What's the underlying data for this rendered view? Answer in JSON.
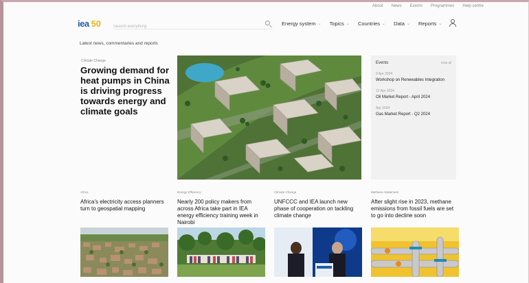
{
  "utility_nav": [
    "About",
    "News",
    "Events",
    "Programmes",
    "Help centre"
  ],
  "logo": {
    "iea": "iea",
    "fifty": "50"
  },
  "search": {
    "placeholder": "Search everything"
  },
  "nav": [
    {
      "label": "Energy system"
    },
    {
      "label": "Topics"
    },
    {
      "label": "Countries"
    },
    {
      "label": "Data"
    },
    {
      "label": "Reports"
    }
  ],
  "section_label": "Latest news, commentaries and reports",
  "hero": {
    "category": "Climate Change",
    "title": "Growing demand for heat pumps in China is driving progress towards energy and climate goals"
  },
  "events": {
    "heading": "Events",
    "view_all": "View all",
    "items": [
      {
        "date": "9 Apr 2024",
        "name": "Workshop on Renewables Integration"
      },
      {
        "date": "12 Apr 2024",
        "name": "Oil Market Report - April 2024"
      },
      {
        "date": "Apr 2024",
        "name": "Gas Market Report - Q2 2024"
      }
    ]
  },
  "cards": [
    {
      "category": "Africa",
      "title": "Africa's electricity access planners turn to geospatial mapping"
    },
    {
      "category": "Energy Efficiency",
      "title": "Nearly 200 policy makers from across Africa take part in IEA energy efficiency training week in Nairobi"
    },
    {
      "category": "Climate Change",
      "title": "UNFCCC and IEA launch new phase of cooperation on tackling climate change"
    },
    {
      "category": "Methane Abatement",
      "title": "After slight rise in 2023, methane emissions from fossil fuels are set to go into decline soon"
    }
  ],
  "colors": {
    "brand_blue": "#1f5fa8",
    "brand_yellow": "#f0b61c",
    "frame_border": "#b8929a"
  }
}
